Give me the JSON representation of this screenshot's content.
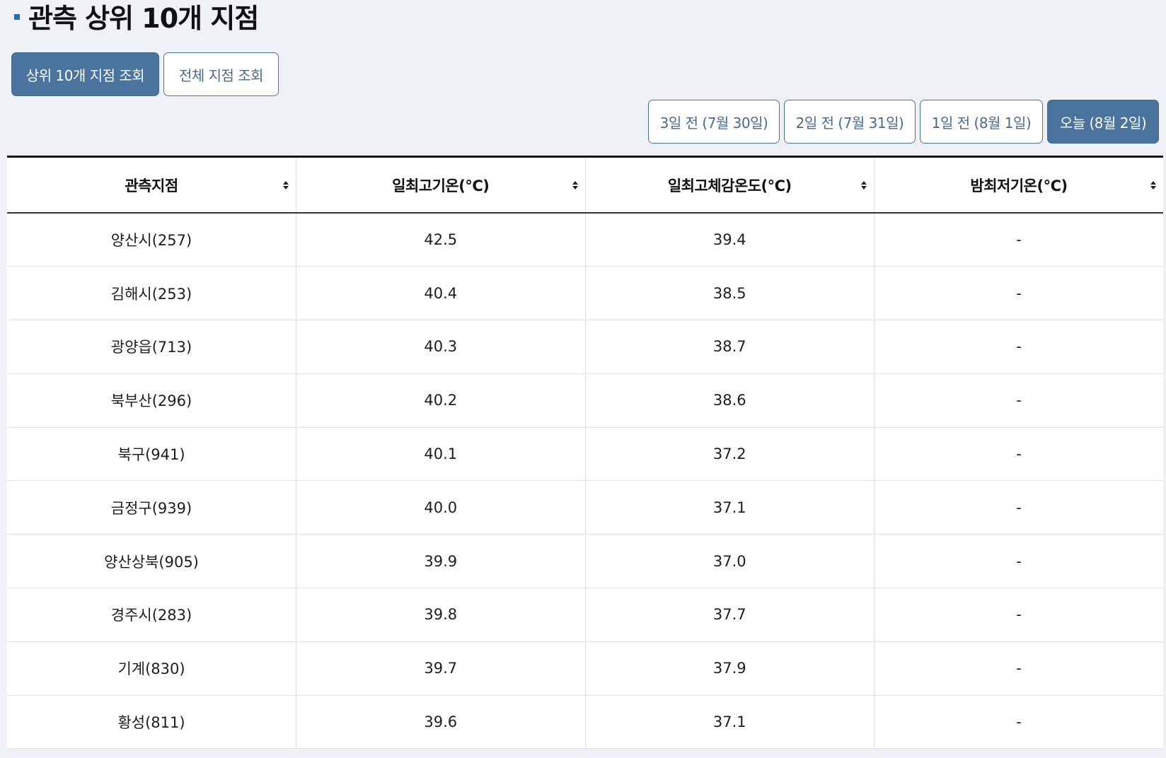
{
  "title": "관측 상위 10개 지점",
  "view_tabs": [
    {
      "label": "상위 10개 지점 조회",
      "active": true
    },
    {
      "label": "전체 지점 조회",
      "active": false
    }
  ],
  "day_tabs": [
    {
      "label": "3일 전  (7월 30일)",
      "active": false
    },
    {
      "label": "2일 전  (7월 31일)",
      "active": false
    },
    {
      "label": "1일 전  (8월 1일)",
      "active": false
    },
    {
      "label": "오늘  (8월 2일)",
      "active": true
    }
  ],
  "table": {
    "columns": [
      "관측지점",
      "일최고기온(°C)",
      "일최고체감온도(°C)",
      "밤최저기온(°C)"
    ],
    "rows": [
      [
        "양산시(257)",
        "42.5",
        "39.4",
        "-"
      ],
      [
        "김해시(253)",
        "40.4",
        "38.5",
        "-"
      ],
      [
        "광양읍(713)",
        "40.3",
        "38.7",
        "-"
      ],
      [
        "북부산(296)",
        "40.2",
        "38.6",
        "-"
      ],
      [
        "북구(941)",
        "40.1",
        "37.2",
        "-"
      ],
      [
        "금정구(939)",
        "40.0",
        "37.1",
        "-"
      ],
      [
        "양산상북(905)",
        "39.9",
        "37.0",
        "-"
      ],
      [
        "경주시(283)",
        "39.8",
        "37.7",
        "-"
      ],
      [
        "기계(830)",
        "39.7",
        "37.9",
        "-"
      ],
      [
        "황성(811)",
        "39.6",
        "37.1",
        "-"
      ]
    ]
  },
  "colors": {
    "primary": "#4a739d",
    "background": "#eef1f6",
    "bullet": "#2f6ea5"
  }
}
